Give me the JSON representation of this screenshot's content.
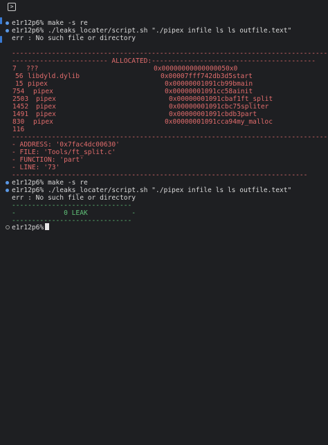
{
  "colors": {
    "background": "#1e1f22",
    "text": "#d8d8d8",
    "error": "#e06c6c",
    "success": "#5fbf77",
    "prompt_dot": "#5a98e6"
  },
  "icons": {
    "toolbar": "terminal-icon"
  },
  "session1": {
    "cmd1": "e1r12p6% make -s re",
    "cmd2": "e1r12p6% ./leaks_locater/script.sh \"./pipex infile ls ls outfile.text\"",
    "err": "err : No such file or directory"
  },
  "report": {
    "rule": "--------------------------------------------------------------------------------",
    "allocated_header": "------------------------ ALLOCATED:-----------------------------------------",
    "rows": [
      {
        "size": "7",
        "lib": "???",
        "addr": "0x0000000000000005",
        "func": "0x0"
      },
      {
        "size": "56",
        "lib": "libdyld.dylib",
        "addr": "0x00007fff742db3d5",
        "func": "start"
      },
      {
        "size": "15",
        "lib": "pipex",
        "addr": "0x00000001091cb99b",
        "func": "main"
      },
      {
        "size": "754",
        "lib": "pipex",
        "addr": "0x00000001091cc58a",
        "func": "init"
      },
      {
        "size": "2503",
        "lib": "pipex",
        "addr": "0x00000001091cbaf1",
        "func": "ft_split"
      },
      {
        "size": "1452",
        "lib": "pipex",
        "addr": "0x00000001091cbc75",
        "func": "spliter"
      },
      {
        "size": "1491",
        "lib": "pipex",
        "addr": "0x00000001091cbdb3",
        "func": "part"
      },
      {
        "size": "830",
        "lib": "pipex",
        "addr": "0x00000001091cca94",
        "func": "my_malloc"
      },
      {
        "size": "116",
        "lib": "",
        "addr": "",
        "func": ""
      }
    ],
    "rule2": "--------------------------------------------------------------------------------",
    "address": "- ADDRESS: '0x7fac4dc00630'",
    "file": "- FILE: 'Tools/ft_split.c'",
    "function": "- FUNCTION: 'part'",
    "line": "- LINE: '73'",
    "rule3": "--------------------------------------------------------------------------"
  },
  "session2": {
    "cmd1": "e1r12p6% make -s re",
    "cmd2": "e1r12p6% ./leaks_locater/script.sh \"./pipex infile ls ls outfile.text\"",
    "err": "err : No such file or directory",
    "rule_top": "------------------------------",
    "leak": "-            0 LEAK           -",
    "rule_bottom": "------------------------------"
  },
  "prompt": "e1r12p6%"
}
